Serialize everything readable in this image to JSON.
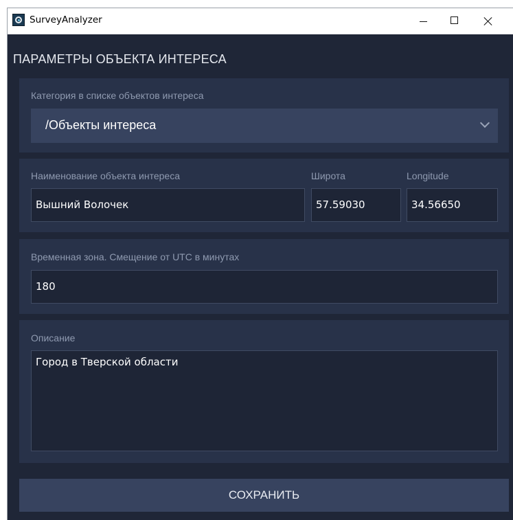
{
  "window": {
    "title": "SurveyAnalyzer",
    "icons": {
      "app": "app-icon",
      "minimize": "minimize-icon",
      "maximize": "maximize-icon",
      "close": "close-icon"
    }
  },
  "page": {
    "heading": "ПАРАМЕТРЫ ОБЪЕКТА ИНТЕРЕСА"
  },
  "category": {
    "label": "Категория в списке объектов интереса",
    "value": "/Объекты интереса"
  },
  "name_section": {
    "name_label": "Наименование объекта интереса",
    "name_value": "Вышний Волочек",
    "lat_label": "Широта",
    "lat_value": "57.59030",
    "lon_label": "Longitude",
    "lon_value": "34.56650"
  },
  "timezone": {
    "label": "Временная зона. Смещение от UTC в минутах",
    "value": "180"
  },
  "description": {
    "label": "Описание",
    "value": "Город в Тверской области"
  },
  "actions": {
    "save_label": "СОХРАНИТЬ"
  },
  "colors": {
    "window_bg": "#1f2637",
    "panel_bg": "#283249",
    "control_bg": "#37435f",
    "label_text": "#8f9ab0"
  }
}
